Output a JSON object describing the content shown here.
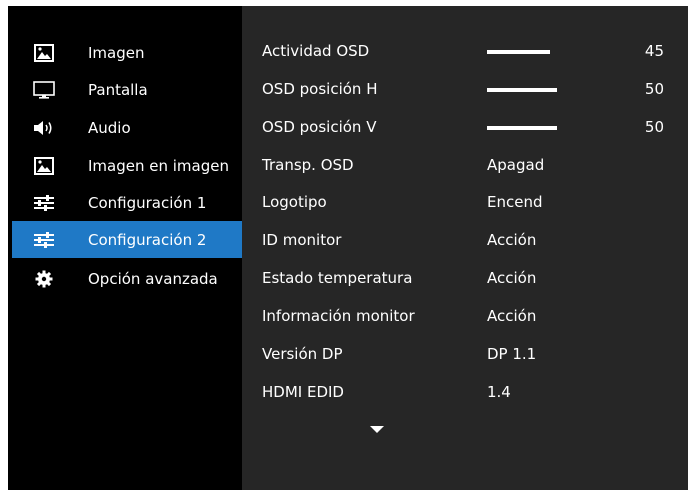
{
  "sidebar": {
    "items": [
      {
        "label": "Imagen",
        "icon": "picture-icon"
      },
      {
        "label": "Pantalla",
        "icon": "monitor-icon"
      },
      {
        "label": "Audio",
        "icon": "speaker-icon"
      },
      {
        "label": "Imagen en imagen",
        "icon": "picture-in-picture-icon"
      },
      {
        "label": "Configuración 1",
        "icon": "sliders-icon"
      },
      {
        "label": "Configuración 2",
        "icon": "sliders-icon"
      },
      {
        "label": "Opción avanzada",
        "icon": "gear-icon"
      }
    ],
    "selected_index": 5
  },
  "settings": [
    {
      "name": "Actividad OSD",
      "level_percent": 45,
      "number": "45"
    },
    {
      "name": "OSD posición H",
      "level_percent": 50,
      "number": "50"
    },
    {
      "name": "OSD posición V",
      "level_percent": 50,
      "number": "50"
    },
    {
      "name": "Transp. OSD",
      "value": "Apagad"
    },
    {
      "name": "Logotipo",
      "value": "Encend"
    },
    {
      "name": "ID monitor",
      "value": "Acción"
    },
    {
      "name": "Estado temperatura",
      "value": "Acción"
    },
    {
      "name": "Información monitor",
      "value": "Acción"
    },
    {
      "name": "Versión DP",
      "value": "DP 1.1"
    },
    {
      "name": "HDMI EDID",
      "value": "1.4"
    }
  ],
  "scroll_indicator_icon": "triangle-down-icon",
  "colors": {
    "accent": "#1f79c6",
    "panel": "#262626",
    "background": "#000000",
    "text": "#ffffff"
  }
}
